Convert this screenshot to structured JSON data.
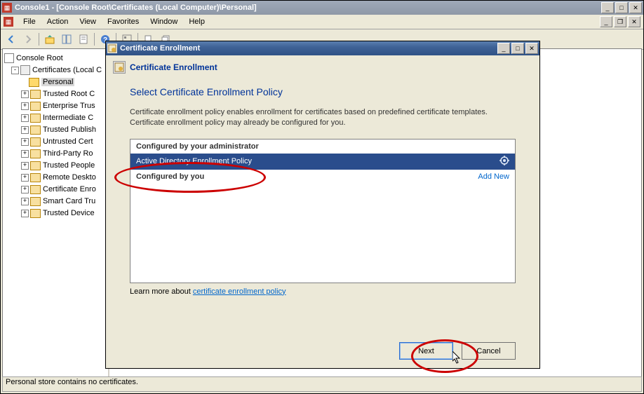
{
  "main_window": {
    "title": "Console1 - [Console Root\\Certificates (Local Computer)\\Personal]",
    "menus": [
      "File",
      "Action",
      "View",
      "Favorites",
      "Window",
      "Help"
    ],
    "statusbar": "Personal store contains no certificates."
  },
  "tree": {
    "root": "Console Root",
    "cert_root": "Certificates (Local C",
    "items": [
      "Personal",
      "Trusted Root C",
      "Enterprise Trus",
      "Intermediate C",
      "Trusted Publish",
      "Untrusted Cert",
      "Third-Party Ro",
      "Trusted People",
      "Remote Deskto",
      "Certificate Enro",
      "Smart Card Tru",
      "Trusted Device"
    ],
    "selected_index": 0
  },
  "dialog": {
    "window_title": "Certificate Enrollment",
    "header": "Certificate Enrollment",
    "step_title": "Select Certificate Enrollment Policy",
    "description": "Certificate enrollment policy enables enrollment for certificates based on predefined certificate templates. Certificate enrollment policy may already be configured for you.",
    "section_admin": "Configured by your administrator",
    "selected_policy": "Active Directory Enrollment Policy",
    "section_user": "Configured by you",
    "add_new": "Add New",
    "learn_prefix": "Learn more about ",
    "learn_link": "certificate enrollment policy",
    "btn_next": "Next",
    "btn_cancel": "Cancel"
  }
}
